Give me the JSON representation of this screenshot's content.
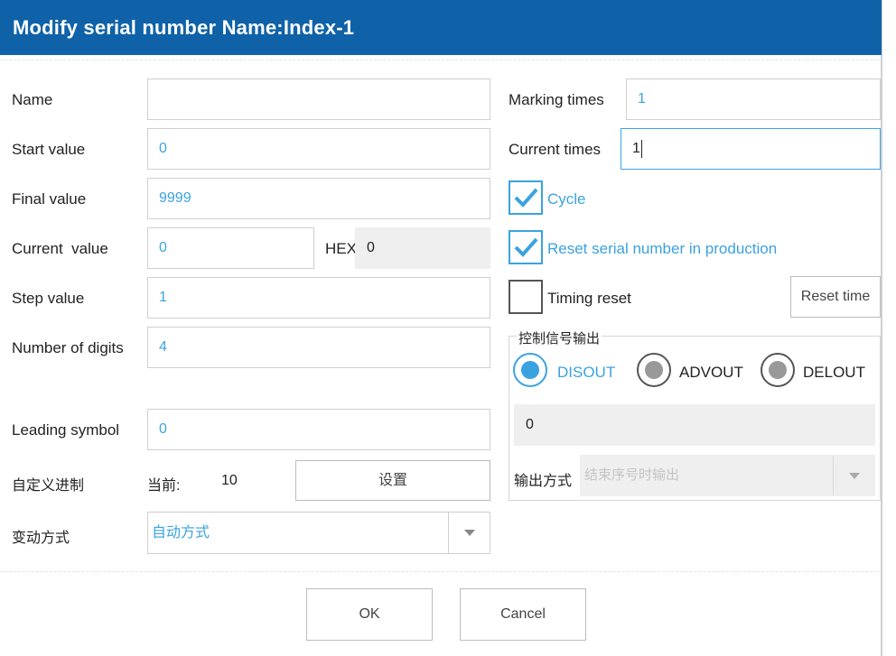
{
  "window": {
    "title": "Modify serial number Name:Index-1"
  },
  "left": {
    "name": {
      "label": "Name",
      "value": ""
    },
    "start_value": {
      "label": "Start value",
      "value": "0"
    },
    "final_value": {
      "label": "Final value",
      "value": "9999"
    },
    "current_value": {
      "label": "Current  value",
      "value": "0",
      "hex_label": "HEX",
      "hex_value": "0"
    },
    "step_value": {
      "label": "Step value",
      "value": "1"
    },
    "digits": {
      "label": "Number of digits",
      "value": "4"
    },
    "leading_symbol": {
      "label": "Leading symbol",
      "value": "0"
    },
    "custom_base": {
      "label": "自定义进制",
      "current_label": "当前:",
      "current_value": "10",
      "button": "设置"
    },
    "change_mode": {
      "label": "变动方式",
      "value": "自动方式"
    }
  },
  "right": {
    "marking_times": {
      "label": "Marking times",
      "value": "1"
    },
    "current_times": {
      "label": "Current times",
      "value": "1"
    },
    "cycle": {
      "label": "Cycle",
      "checked": true
    },
    "reset_in_production": {
      "label": "Reset serial number in production",
      "checked": true
    },
    "timing_reset": {
      "label": "Timing reset",
      "checked": false,
      "button": "Reset time"
    },
    "signal_group": {
      "legend": "控制信号输出",
      "options": [
        {
          "label": "DISOUT",
          "selected": true
        },
        {
          "label": "ADVOUT",
          "selected": false
        },
        {
          "label": "DELOUT",
          "selected": false
        }
      ],
      "value": "0",
      "output_mode_label": "输出方式",
      "output_mode_value": "结束序号时输出"
    }
  },
  "footer": {
    "ok": "OK",
    "cancel": "Cancel"
  },
  "colors": {
    "titlebar": "#0f62a7",
    "accent": "#3aa3df"
  }
}
